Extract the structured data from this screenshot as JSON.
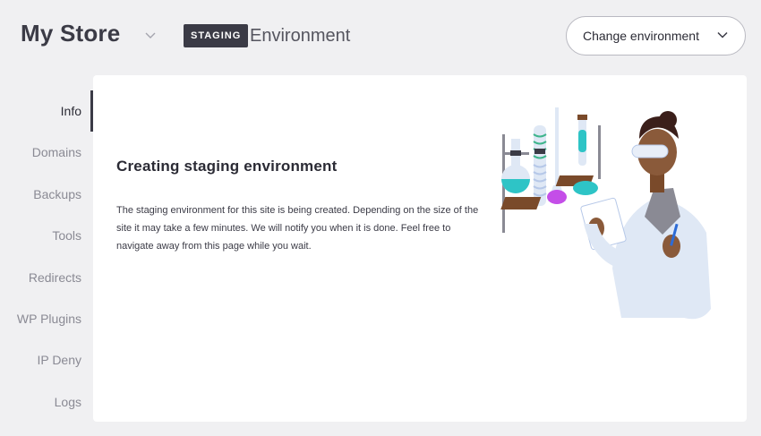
{
  "header": {
    "site_name": "My Store",
    "environment_badge": "STAGING",
    "environment_title": "Environment",
    "change_environment_label": "Change environment"
  },
  "sidebar": {
    "items": [
      {
        "label": "Info",
        "active": true
      },
      {
        "label": "Domains"
      },
      {
        "label": "Backups"
      },
      {
        "label": "Tools"
      },
      {
        "label": "Redirects"
      },
      {
        "label": "WP Plugins"
      },
      {
        "label": "IP Deny"
      },
      {
        "label": "Logs"
      }
    ]
  },
  "main": {
    "title": "Creating staging environment",
    "body": "The staging environment for this site is being created. Depending on the size of the site it may take a few minutes. We will notify you when it is done. Feel free to navigate away from this page while you wait."
  },
  "colors": {
    "background": "#f0f0f2",
    "badge": "#3b3b46",
    "accent_teal": "#2ec4c6",
    "accent_purple": "#a23fe0"
  },
  "icons": {
    "site_dropdown": "chevron-down-icon",
    "change_env_dropdown": "chevron-down-icon",
    "illustration": "scientist-lab-illustration"
  }
}
